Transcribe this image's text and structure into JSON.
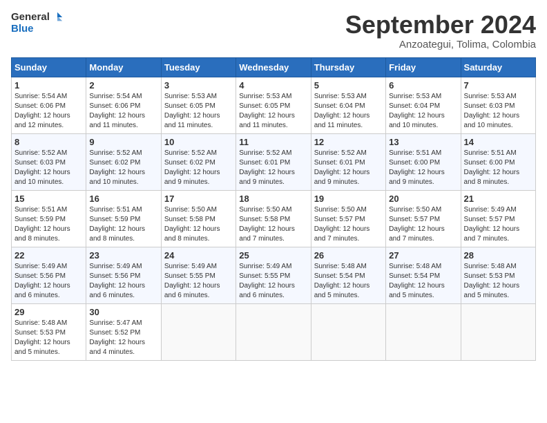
{
  "logo": {
    "line1": "General",
    "line2": "Blue"
  },
  "title": "September 2024",
  "subtitle": "Anzoategui, Tolima, Colombia",
  "headers": [
    "Sunday",
    "Monday",
    "Tuesday",
    "Wednesday",
    "Thursday",
    "Friday",
    "Saturday"
  ],
  "weeks": [
    [
      {
        "day": "1",
        "rise": "5:54 AM",
        "set": "6:06 PM",
        "daylight": "12 hours and 12 minutes."
      },
      {
        "day": "2",
        "rise": "5:54 AM",
        "set": "6:06 PM",
        "daylight": "12 hours and 11 minutes."
      },
      {
        "day": "3",
        "rise": "5:53 AM",
        "set": "6:05 PM",
        "daylight": "12 hours and 11 minutes."
      },
      {
        "day": "4",
        "rise": "5:53 AM",
        "set": "6:05 PM",
        "daylight": "12 hours and 11 minutes."
      },
      {
        "day": "5",
        "rise": "5:53 AM",
        "set": "6:04 PM",
        "daylight": "12 hours and 11 minutes."
      },
      {
        "day": "6",
        "rise": "5:53 AM",
        "set": "6:04 PM",
        "daylight": "12 hours and 10 minutes."
      },
      {
        "day": "7",
        "rise": "5:53 AM",
        "set": "6:03 PM",
        "daylight": "12 hours and 10 minutes."
      }
    ],
    [
      {
        "day": "8",
        "rise": "5:52 AM",
        "set": "6:03 PM",
        "daylight": "12 hours and 10 minutes."
      },
      {
        "day": "9",
        "rise": "5:52 AM",
        "set": "6:02 PM",
        "daylight": "12 hours and 10 minutes."
      },
      {
        "day": "10",
        "rise": "5:52 AM",
        "set": "6:02 PM",
        "daylight": "12 hours and 9 minutes."
      },
      {
        "day": "11",
        "rise": "5:52 AM",
        "set": "6:01 PM",
        "daylight": "12 hours and 9 minutes."
      },
      {
        "day": "12",
        "rise": "5:52 AM",
        "set": "6:01 PM",
        "daylight": "12 hours and 9 minutes."
      },
      {
        "day": "13",
        "rise": "5:51 AM",
        "set": "6:00 PM",
        "daylight": "12 hours and 9 minutes."
      },
      {
        "day": "14",
        "rise": "5:51 AM",
        "set": "6:00 PM",
        "daylight": "12 hours and 8 minutes."
      }
    ],
    [
      {
        "day": "15",
        "rise": "5:51 AM",
        "set": "5:59 PM",
        "daylight": "12 hours and 8 minutes."
      },
      {
        "day": "16",
        "rise": "5:51 AM",
        "set": "5:59 PM",
        "daylight": "12 hours and 8 minutes."
      },
      {
        "day": "17",
        "rise": "5:50 AM",
        "set": "5:58 PM",
        "daylight": "12 hours and 8 minutes."
      },
      {
        "day": "18",
        "rise": "5:50 AM",
        "set": "5:58 PM",
        "daylight": "12 hours and 7 minutes."
      },
      {
        "day": "19",
        "rise": "5:50 AM",
        "set": "5:57 PM",
        "daylight": "12 hours and 7 minutes."
      },
      {
        "day": "20",
        "rise": "5:50 AM",
        "set": "5:57 PM",
        "daylight": "12 hours and 7 minutes."
      },
      {
        "day": "21",
        "rise": "5:49 AM",
        "set": "5:57 PM",
        "daylight": "12 hours and 7 minutes."
      }
    ],
    [
      {
        "day": "22",
        "rise": "5:49 AM",
        "set": "5:56 PM",
        "daylight": "12 hours and 6 minutes."
      },
      {
        "day": "23",
        "rise": "5:49 AM",
        "set": "5:56 PM",
        "daylight": "12 hours and 6 minutes."
      },
      {
        "day": "24",
        "rise": "5:49 AM",
        "set": "5:55 PM",
        "daylight": "12 hours and 6 minutes."
      },
      {
        "day": "25",
        "rise": "5:49 AM",
        "set": "5:55 PM",
        "daylight": "12 hours and 6 minutes."
      },
      {
        "day": "26",
        "rise": "5:48 AM",
        "set": "5:54 PM",
        "daylight": "12 hours and 5 minutes."
      },
      {
        "day": "27",
        "rise": "5:48 AM",
        "set": "5:54 PM",
        "daylight": "12 hours and 5 minutes."
      },
      {
        "day": "28",
        "rise": "5:48 AM",
        "set": "5:53 PM",
        "daylight": "12 hours and 5 minutes."
      }
    ],
    [
      {
        "day": "29",
        "rise": "5:48 AM",
        "set": "5:53 PM",
        "daylight": "12 hours and 5 minutes."
      },
      {
        "day": "30",
        "rise": "5:47 AM",
        "set": "5:52 PM",
        "daylight": "12 hours and 4 minutes."
      },
      null,
      null,
      null,
      null,
      null
    ]
  ],
  "labels": {
    "sunrise": "Sunrise:",
    "sunset": "Sunset:",
    "daylight": "Daylight:"
  }
}
